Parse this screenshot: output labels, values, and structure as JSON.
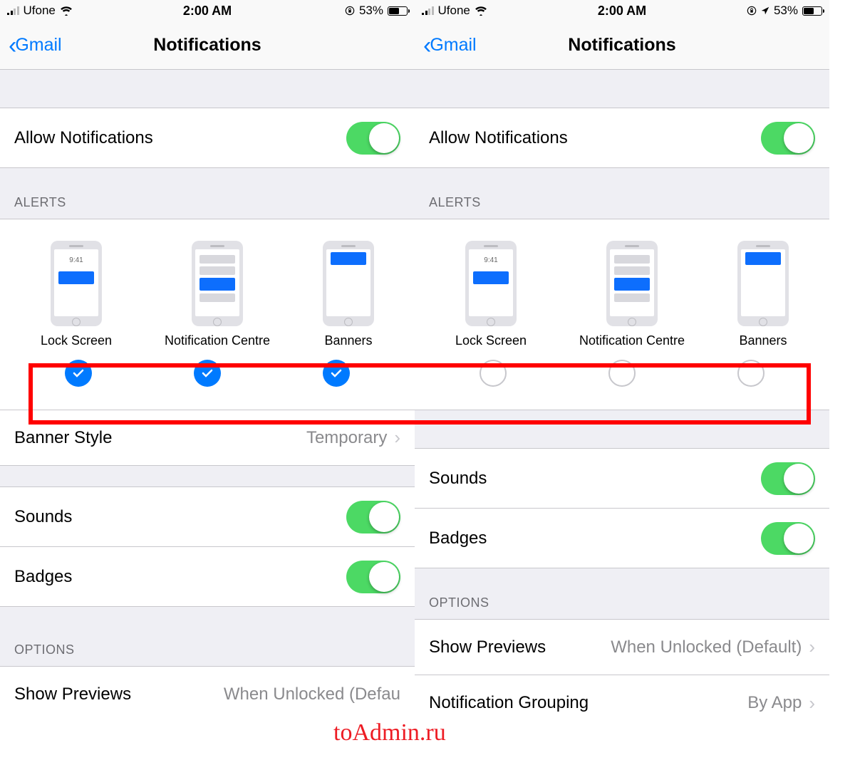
{
  "status": {
    "carrier": "Ufone",
    "time": "2:00 AM",
    "battery_pct": "53%"
  },
  "nav": {
    "back_label": "Gmail",
    "title": "Notifications"
  },
  "rows": {
    "allow": "Allow Notifications",
    "banner_style": "Banner Style",
    "banner_style_value": "Temporary",
    "sounds": "Sounds",
    "badges": "Badges",
    "show_previews": "Show Previews",
    "show_previews_value": "When Unlocked (Default)",
    "show_previews_value_cut": "When Unlocked (Defau",
    "notification_grouping": "Notification Grouping",
    "notification_grouping_value": "By App"
  },
  "headers": {
    "alerts": "ALERTS",
    "options": "OPTIONS"
  },
  "alerts": {
    "lock_screen": "Lock Screen",
    "notification_centre": "Notification Centre",
    "banners": "Banners",
    "mock_time": "9:41"
  },
  "watermark": "toAdmin.ru"
}
